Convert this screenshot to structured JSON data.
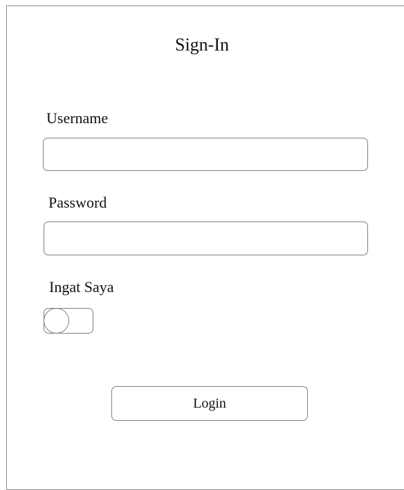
{
  "form": {
    "title": "Sign-In",
    "username_label": "Username",
    "username_value": "",
    "password_label": "Password",
    "password_value": "",
    "remember_label": "Ingat Saya",
    "remember_on": false,
    "login_label": "Login"
  }
}
